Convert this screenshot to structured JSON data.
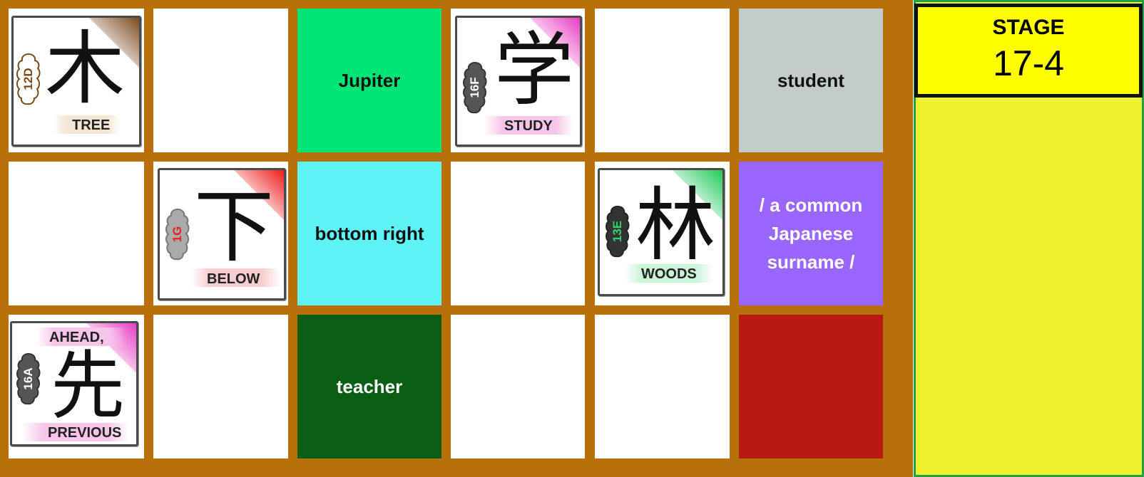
{
  "stage": {
    "label": "STAGE",
    "number": "17-4",
    "panel_color": "#eef22e",
    "box_color": "#ffff00"
  },
  "board": {
    "frame_color": "#b8700a",
    "rows": 3,
    "cols": 6
  },
  "cards": [
    {
      "kanji": "木",
      "meaning": "TREE",
      "code": "12D",
      "accent": "#7a4a1e",
      "badge_color": "#ffffff",
      "badge_outline": "#7a4a1e",
      "code_color": "#7a4a1e",
      "label_bg": "#f3e6d4"
    },
    {
      "kanji": "学",
      "meaning": "STUDY",
      "code": "16F",
      "accent": "#e83cc4",
      "badge_color": "#555555",
      "badge_outline": "#333333",
      "code_color": "#ffffff",
      "label_bg": "#f7c5ea"
    },
    {
      "kanji": "下",
      "meaning": "BELOW",
      "code": "1G",
      "accent": "#ee1c1c",
      "badge_color": "#aaaaaa",
      "badge_outline": "#777777",
      "code_color": "#ee1c1c",
      "label_bg": "#f8cdd0"
    },
    {
      "kanji": "林",
      "meaning": "WOODS",
      "code": "13E",
      "accent": "#1ec95a",
      "badge_color": "#333333",
      "badge_outline": "#222222",
      "code_color": "#2fd66b",
      "label_bg": "#c9f2d6"
    },
    {
      "kanji": "先",
      "meaning_top": "AHEAD,",
      "meaning": "PREVIOUS",
      "code": "16A",
      "accent": "#e83cc4",
      "badge_color": "#555555",
      "badge_outline": "#333333",
      "code_color": "#ffffff",
      "label_bg": "#f7c5ea"
    }
  ],
  "clues": [
    {
      "text": "Jupiter",
      "bg": "#00e676",
      "color": "#111111"
    },
    {
      "text": "student",
      "bg": "#c2cccb",
      "color": "#111111"
    },
    {
      "text": "bottom right",
      "bg": "#5ef3f6",
      "color": "#111111"
    },
    {
      "text": "/ a common Japanese surname /",
      "bg": "#9966ff",
      "color": "#ffffff"
    },
    {
      "text": "teacher",
      "bg": "#0a5e14",
      "color": "#ffffff"
    },
    {
      "text": "",
      "bg": "#b81a10",
      "color": "#ffffff"
    }
  ]
}
